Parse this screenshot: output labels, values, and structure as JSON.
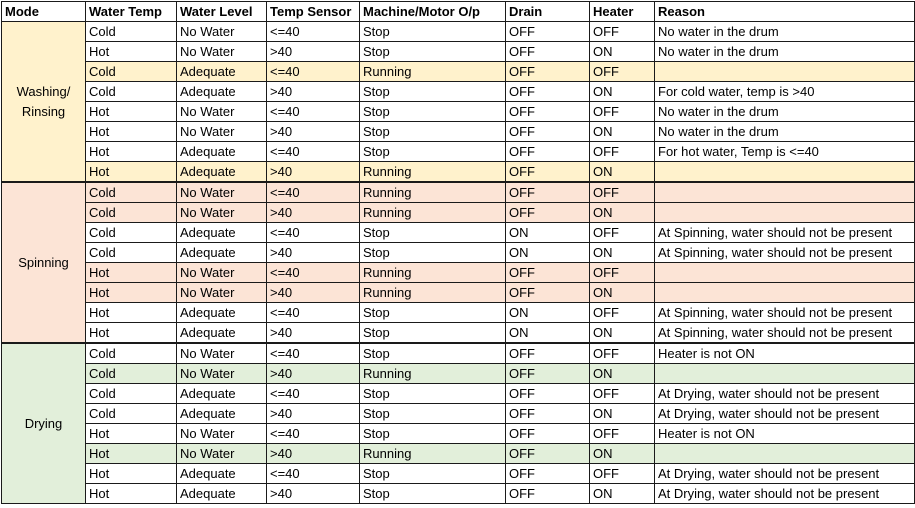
{
  "headers": [
    "Mode",
    "Water Temp",
    "Water Level",
    "Temp Sensor",
    "Machine/Motor  O/p",
    "Drain",
    "Heater",
    "Reason"
  ],
  "colors": {
    "washing_mode": "#FFF2CC",
    "spinning_mode": "#FCE4D6",
    "drying_mode": "#E2EFDA",
    "washing_highlight": "#FFF2CC",
    "spinning_highlight": "#FCE4D6",
    "drying_highlight": "#E2EFDA"
  },
  "groups": [
    {
      "mode": "Washing/ Rinsing",
      "color_key": "washing",
      "rows": [
        {
          "cells": [
            "Cold",
            "No Water",
            "<=40",
            "Stop",
            "OFF",
            "OFF",
            "No water in the drum"
          ],
          "highlight": false
        },
        {
          "cells": [
            "Hot",
            "No Water",
            ">40",
            "Stop",
            "OFF",
            "ON",
            "No water in the drum"
          ],
          "highlight": false
        },
        {
          "cells": [
            "Cold",
            "Adequate",
            "<=40",
            "Running",
            "OFF",
            "OFF",
            ""
          ],
          "highlight": true
        },
        {
          "cells": [
            "Cold",
            "Adequate",
            ">40",
            "Stop",
            "OFF",
            "ON",
            "For cold water, temp is >40"
          ],
          "highlight": false
        },
        {
          "cells": [
            "Hot",
            "No Water",
            "<=40",
            "Stop",
            "OFF",
            "OFF",
            "No water in the drum"
          ],
          "highlight": false
        },
        {
          "cells": [
            "Hot",
            "No Water",
            ">40",
            "Stop",
            "OFF",
            "ON",
            "No water in the drum"
          ],
          "highlight": false
        },
        {
          "cells": [
            "Hot",
            "Adequate",
            "<=40",
            "Stop",
            "OFF",
            "OFF",
            "For hot water, Temp is <=40"
          ],
          "highlight": false
        },
        {
          "cells": [
            "Hot",
            "Adequate",
            ">40",
            "Running",
            "OFF",
            "ON",
            ""
          ],
          "highlight": true
        }
      ]
    },
    {
      "mode": "Spinning",
      "color_key": "spinning",
      "rows": [
        {
          "cells": [
            "Cold",
            "No Water",
            "<=40",
            "Running",
            "OFF",
            "OFF",
            ""
          ],
          "highlight": true
        },
        {
          "cells": [
            "Cold",
            "No Water",
            ">40",
            "Running",
            "OFF",
            "ON",
            ""
          ],
          "highlight": true
        },
        {
          "cells": [
            "Cold",
            "Adequate",
            "<=40",
            "Stop",
            "ON",
            "OFF",
            "At Spinning, water should not be present"
          ],
          "highlight": false
        },
        {
          "cells": [
            "Cold",
            "Adequate",
            ">40",
            "Stop",
            "ON",
            "ON",
            "At Spinning, water should not be present"
          ],
          "highlight": false
        },
        {
          "cells": [
            "Hot",
            "No Water",
            "<=40",
            "Running",
            "OFF",
            "OFF",
            ""
          ],
          "highlight": true
        },
        {
          "cells": [
            "Hot",
            "No Water",
            ">40",
            "Running",
            "OFF",
            "ON",
            ""
          ],
          "highlight": true
        },
        {
          "cells": [
            "Hot",
            "Adequate",
            "<=40",
            "Stop",
            "ON",
            "OFF",
            "At Spinning, water should not be present"
          ],
          "highlight": false
        },
        {
          "cells": [
            "Hot",
            "Adequate",
            ">40",
            "Stop",
            "ON",
            "ON",
            "At Spinning, water should not be present"
          ],
          "highlight": false
        }
      ]
    },
    {
      "mode": "Drying",
      "color_key": "drying",
      "rows": [
        {
          "cells": [
            "Cold",
            "No Water",
            "<=40",
            "Stop",
            "OFF",
            "OFF",
            "Heater is not ON"
          ],
          "highlight": false
        },
        {
          "cells": [
            "Cold",
            "No Water",
            ">40",
            "Running",
            "OFF",
            "ON",
            ""
          ],
          "highlight": true
        },
        {
          "cells": [
            "Cold",
            "Adequate",
            "<=40",
            "Stop",
            "OFF",
            "OFF",
            "At Drying, water should not be present"
          ],
          "highlight": false
        },
        {
          "cells": [
            "Cold",
            "Adequate",
            ">40",
            "Stop",
            "OFF",
            "ON",
            "At Drying, water should not be present"
          ],
          "highlight": false
        },
        {
          "cells": [
            "Hot",
            "No Water",
            "<=40",
            "Stop",
            "OFF",
            "OFF",
            "Heater is not ON"
          ],
          "highlight": false
        },
        {
          "cells": [
            "Hot",
            "No Water",
            ">40",
            "Running",
            "OFF",
            "ON",
            ""
          ],
          "highlight": true
        },
        {
          "cells": [
            "Hot",
            "Adequate",
            "<=40",
            "Stop",
            "OFF",
            "OFF",
            "At Drying, water should not be present"
          ],
          "highlight": false
        },
        {
          "cells": [
            "Hot",
            "Adequate",
            ">40",
            "Stop",
            "OFF",
            "ON",
            "At Drying, water should not be present"
          ],
          "highlight": false
        }
      ]
    }
  ]
}
